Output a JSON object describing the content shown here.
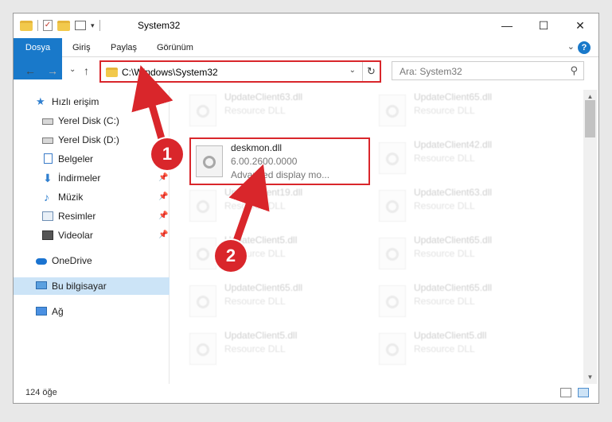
{
  "window": {
    "title": "System32",
    "controls": {
      "minimize": "—",
      "maximize": "☐",
      "close": "✕"
    }
  },
  "ribbon": {
    "tabs": [
      "Dosya",
      "Giriş",
      "Paylaş",
      "Görünüm"
    ],
    "help": "?"
  },
  "nav": {
    "back": "←",
    "forward": "→",
    "recent": "⌄",
    "up": "↑",
    "address": "C:\\Windows\\System32",
    "search_placeholder": "Ara: System32"
  },
  "sidebar": {
    "items": [
      {
        "label": "Hızlı erişim",
        "icon": "star-icon",
        "pinned": false
      },
      {
        "label": "Yerel Disk (C:)",
        "icon": "drive-icon",
        "pinned": false
      },
      {
        "label": "Yerel Disk (D:)",
        "icon": "drive-icon",
        "pinned": false
      },
      {
        "label": "Belgeler",
        "icon": "documents-icon",
        "pinned": true
      },
      {
        "label": "İndirmeler",
        "icon": "downloads-icon",
        "pinned": true
      },
      {
        "label": "Müzik",
        "icon": "music-icon",
        "pinned": true
      },
      {
        "label": "Resimler",
        "icon": "pictures-icon",
        "pinned": true
      },
      {
        "label": "Videolar",
        "icon": "videos-icon",
        "pinned": true
      },
      {
        "label": "OneDrive",
        "icon": "cloud-icon",
        "pinned": false
      },
      {
        "label": "Bu bilgisayar",
        "icon": "computer-icon",
        "pinned": false,
        "selected": true
      },
      {
        "label": "Ağ",
        "icon": "network-icon",
        "pinned": false
      }
    ]
  },
  "files": {
    "highlighted": {
      "name": "deskmon.dll",
      "version": "6.00.2600.0000",
      "description": "Advanced display mo..."
    },
    "background": [
      {
        "name": "UpdateClient63.dll",
        "type": "Resource DLL"
      },
      {
        "name": "UpdateClient65.dll",
        "type": "Resource DLL"
      },
      {
        "name": "UpdateClient42.dll",
        "type": "Resource DLL"
      },
      {
        "name": "UpdateClient19.dll",
        "type": "Resource DLL"
      },
      {
        "name": "UpdateClient63.dll",
        "type": "Resource DLL"
      },
      {
        "name": "UpdateClient5.dll",
        "type": "Resource DLL"
      },
      {
        "name": "UpdateClient65.dll",
        "type": "Resource DLL"
      },
      {
        "name": "UpdateClient65.dll",
        "type": "Resource DLL"
      },
      {
        "name": "UpdateClient5.dll",
        "type": "Resource DLL"
      },
      {
        "name": "UpdateClient5.dll",
        "type": "Resource DLL"
      },
      {
        "name": "UpdateClient65.dll",
        "type": "Resource DLL"
      }
    ]
  },
  "status": {
    "item_count": "124 öğe"
  },
  "annotations": {
    "step1": "1",
    "step2": "2",
    "accent_color": "#d9262b"
  }
}
